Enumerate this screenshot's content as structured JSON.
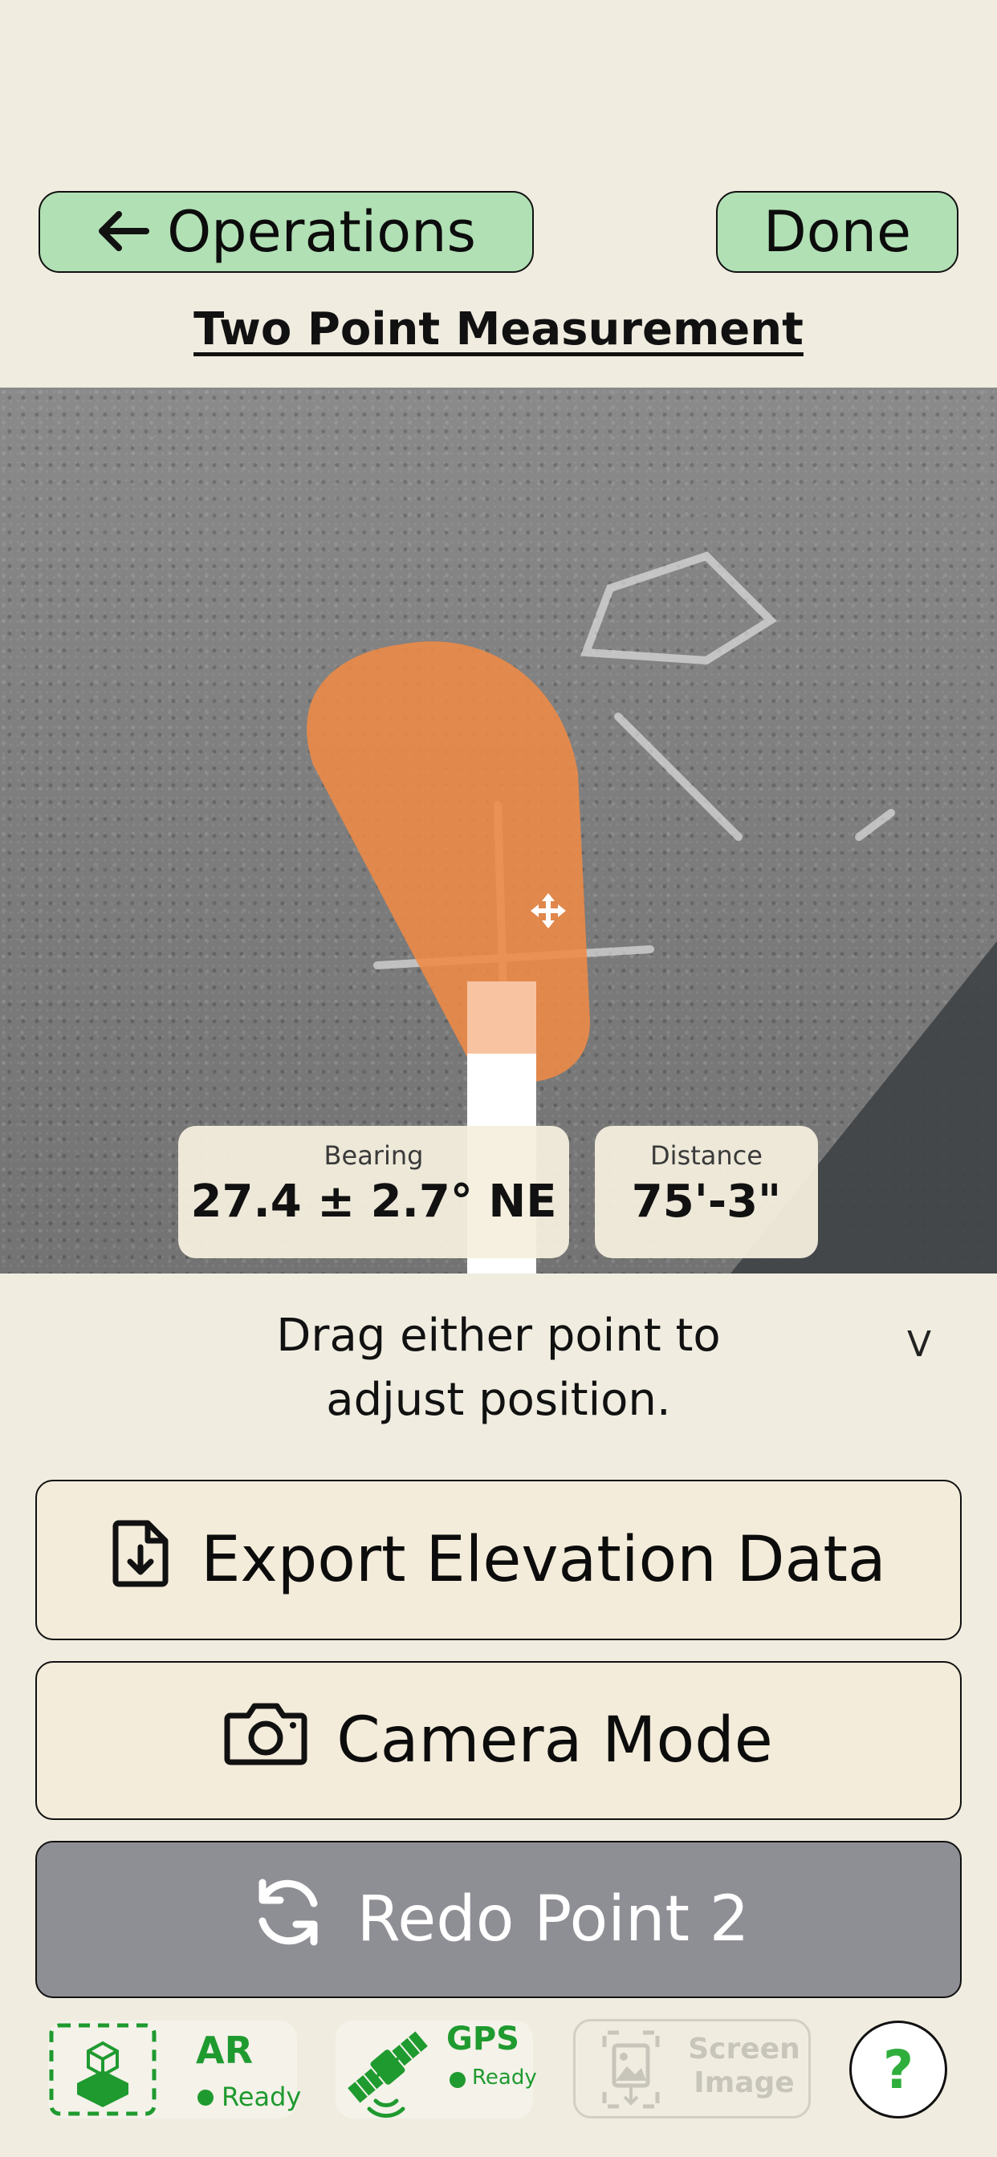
{
  "nav": {
    "back_label": "Operations",
    "done_label": "Done"
  },
  "page_title": "Two Point Measurement",
  "readouts": {
    "bearing_label": "Bearing",
    "bearing_value": "27.4 ± 2.7° NE",
    "distance_label": "Distance",
    "distance_value": "75'-3\""
  },
  "instruction": "Drag either point to adjust position.",
  "collapse_glyph": "V",
  "actions": {
    "export_label": "Export Elevation Data",
    "camera_label": "Camera Mode",
    "redo_label": "Redo Point 2"
  },
  "status_bar": {
    "ar_title": "AR",
    "ar_state": "Ready",
    "gps_title": "GPS",
    "gps_state": "Ready",
    "screen_image_label": "Screen Image",
    "help_glyph": "?"
  },
  "colors": {
    "accent_green": "#b1e0b5",
    "status_green": "#1f9a2f",
    "marker_orange": "#ef8a45",
    "redo_gray": "#8e8e95"
  }
}
